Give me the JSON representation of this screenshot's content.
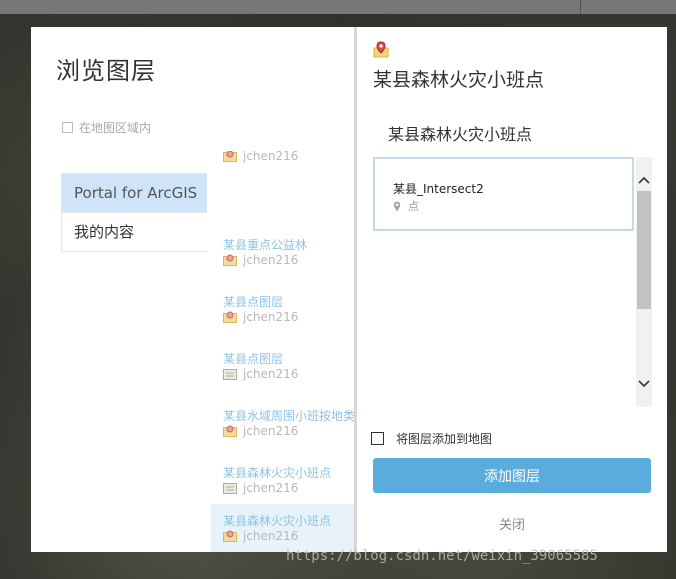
{
  "left_panel": {
    "title": "浏览图层",
    "in_extent_label": "在地图区域内",
    "sources": [
      {
        "label": "Portal for ArcGIS",
        "active": true
      },
      {
        "label": "我的内容",
        "active": false
      }
    ],
    "results": [
      {
        "title": "",
        "owner": "jchen216",
        "icon": "map-icon"
      },
      {
        "title": "某县重点公益林",
        "owner": "jchen216",
        "icon": "map-icon"
      },
      {
        "title": "某县点图层",
        "owner": "jchen216",
        "icon": "map-icon"
      },
      {
        "title": "某县点图层",
        "owner": "jchen216",
        "icon": "layer-card-icon"
      },
      {
        "title": "某县水域周围小班按地类",
        "owner": "jchen216",
        "icon": "map-icon"
      },
      {
        "title": "某县森林火灾小班点",
        "owner": "jchen216",
        "icon": "layer-card-icon"
      },
      {
        "title": "某县森林火灾小班点",
        "owner": "jchen216",
        "icon": "map-icon",
        "selected": true
      }
    ]
  },
  "right_panel": {
    "heading": "某县森林火灾小班点",
    "subheading": "某县森林火灾小班点",
    "sublayers": [
      {
        "name": "某县_Intersect2",
        "type": "点"
      }
    ],
    "add_to_map_label": "将图层添加到地图",
    "add_button_label": "添加图层",
    "close_label": "关闭"
  },
  "watermark": "https://blog.csdn.net/weixin_39065585",
  "colors": {
    "accent": "#5aacdc",
    "active_source_bg": "#cfe5f7",
    "result_title": "#8cc3e6"
  }
}
